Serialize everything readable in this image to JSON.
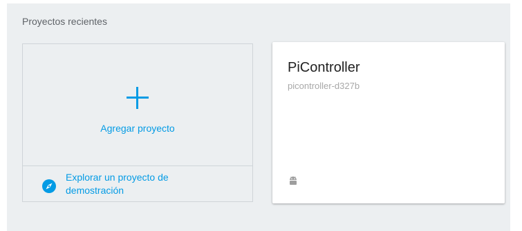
{
  "section": {
    "title": "Proyectos recientes"
  },
  "add_card": {
    "icon": "plus-icon",
    "label": "Agregar proyecto",
    "demo_icon": "compass-icon",
    "demo_label": "Explorar un proyecto de demostración",
    "accent_color": "#039be5"
  },
  "project_card": {
    "name": "PiController",
    "id": "picontroller-d327b",
    "platform_icon": "android-icon"
  }
}
